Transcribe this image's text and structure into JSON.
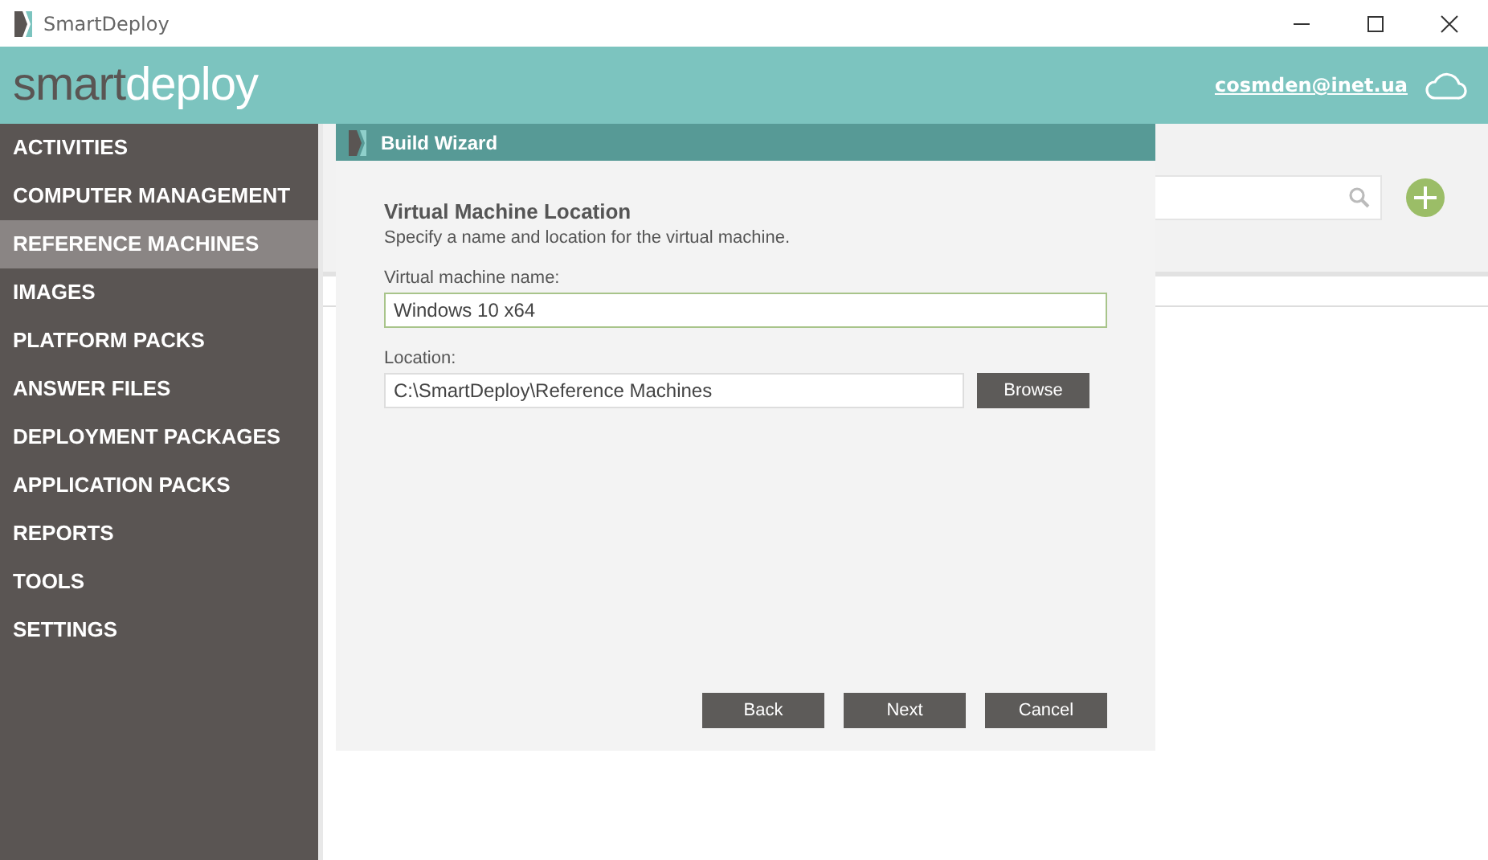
{
  "window": {
    "title": "SmartDeploy"
  },
  "header": {
    "logo": [
      "smart",
      "deploy"
    ],
    "account": "cosmden@inet.ua"
  },
  "sidebar": {
    "items": [
      {
        "label": "ACTIVITIES",
        "selected": false
      },
      {
        "label": "COMPUTER MANAGEMENT",
        "selected": false
      },
      {
        "label": "REFERENCE MACHINES",
        "selected": true
      },
      {
        "label": "IMAGES",
        "selected": false
      },
      {
        "label": "PLATFORM PACKS",
        "selected": false
      },
      {
        "label": "ANSWER FILES",
        "selected": false
      },
      {
        "label": "DEPLOYMENT PACKAGES",
        "selected": false
      },
      {
        "label": "APPLICATION PACKS",
        "selected": false
      },
      {
        "label": "REPORTS",
        "selected": false
      },
      {
        "label": "TOOLS",
        "selected": false
      },
      {
        "label": "SETTINGS",
        "selected": false
      }
    ]
  },
  "wizard": {
    "title": "Build Wizard",
    "heading": "Virtual Machine Location",
    "description": "Specify a name and location for the virtual machine.",
    "fields": [
      {
        "label": "Virtual machine name:",
        "value": "Windows 10 x64",
        "focused": true
      },
      {
        "label": "Location:",
        "value": "C:\\SmartDeploy\\Reference Machines",
        "focused": false,
        "button": "Browse"
      }
    ],
    "buttons": [
      "Back",
      "Next",
      "Cancel"
    ]
  }
}
